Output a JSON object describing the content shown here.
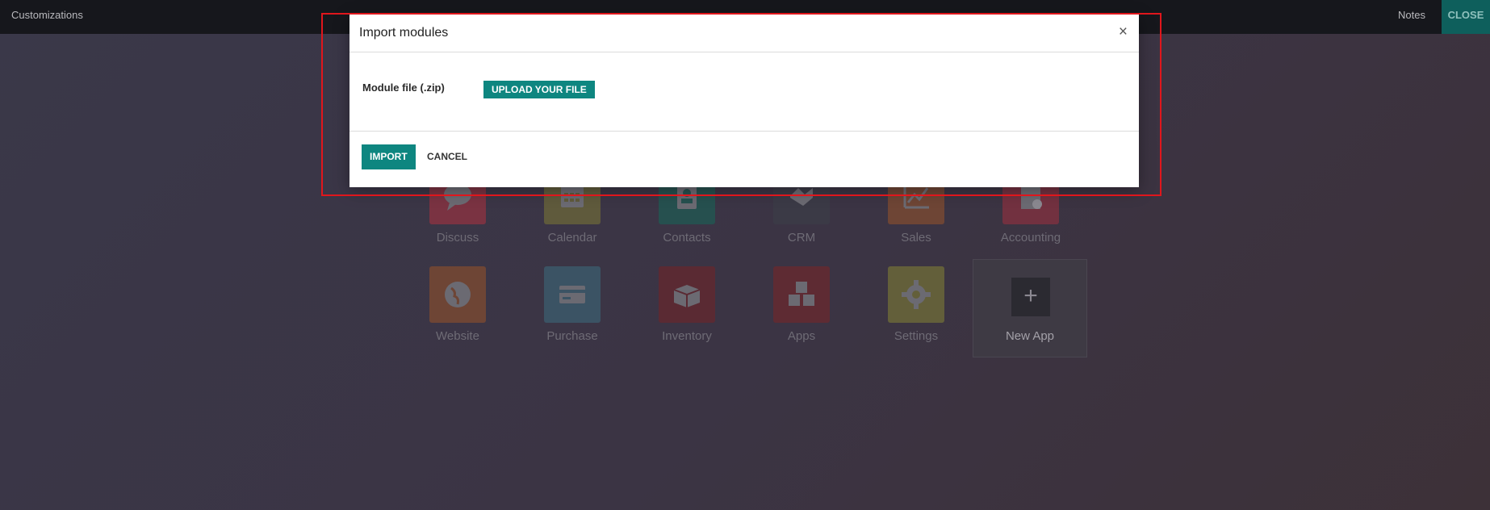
{
  "topbar": {
    "title": "Customizations",
    "notes": "Notes",
    "close": "CLOSE"
  },
  "apps_row1": [
    {
      "label": "Discuss",
      "icon": "chat-icon",
      "color": "#9c3548"
    },
    {
      "label": "Calendar",
      "icon": "calendar-icon",
      "color": "#7f6e3b"
    },
    {
      "label": "Contacts",
      "icon": "contact-card-icon",
      "color": "#1d5c5c"
    },
    {
      "label": "CRM",
      "icon": "handshake-icon",
      "color": "#3f3f4b"
    },
    {
      "label": "Sales",
      "icon": "trend-chart-icon",
      "color": "#8a4e35"
    },
    {
      "label": "Accounting",
      "icon": "document-gear-icon",
      "color": "#8c3342"
    }
  ],
  "apps_row2": [
    {
      "label": "Website",
      "icon": "globe-icon",
      "color": "#8d4d36"
    },
    {
      "label": "Purchase",
      "icon": "credit-card-icon",
      "color": "#3d5f71"
    },
    {
      "label": "Inventory",
      "icon": "box-icon",
      "color": "#6a2a33"
    },
    {
      "label": "Apps",
      "icon": "cubes-icon",
      "color": "#6f2b33"
    },
    {
      "label": "Settings",
      "icon": "gear-icon",
      "color": "#77713b"
    }
  ],
  "new_app": {
    "label": "New App",
    "icon": "plus-icon"
  },
  "modal": {
    "title": "Import modules",
    "close_symbol": "×",
    "field_label": "Module file (.zip)",
    "upload_label": "UPLOAD YOUR FILE",
    "import_label": "IMPORT",
    "cancel_label": "CANCEL"
  },
  "colors": {
    "accent": "#0e8680",
    "highlight": "#e0161c"
  }
}
